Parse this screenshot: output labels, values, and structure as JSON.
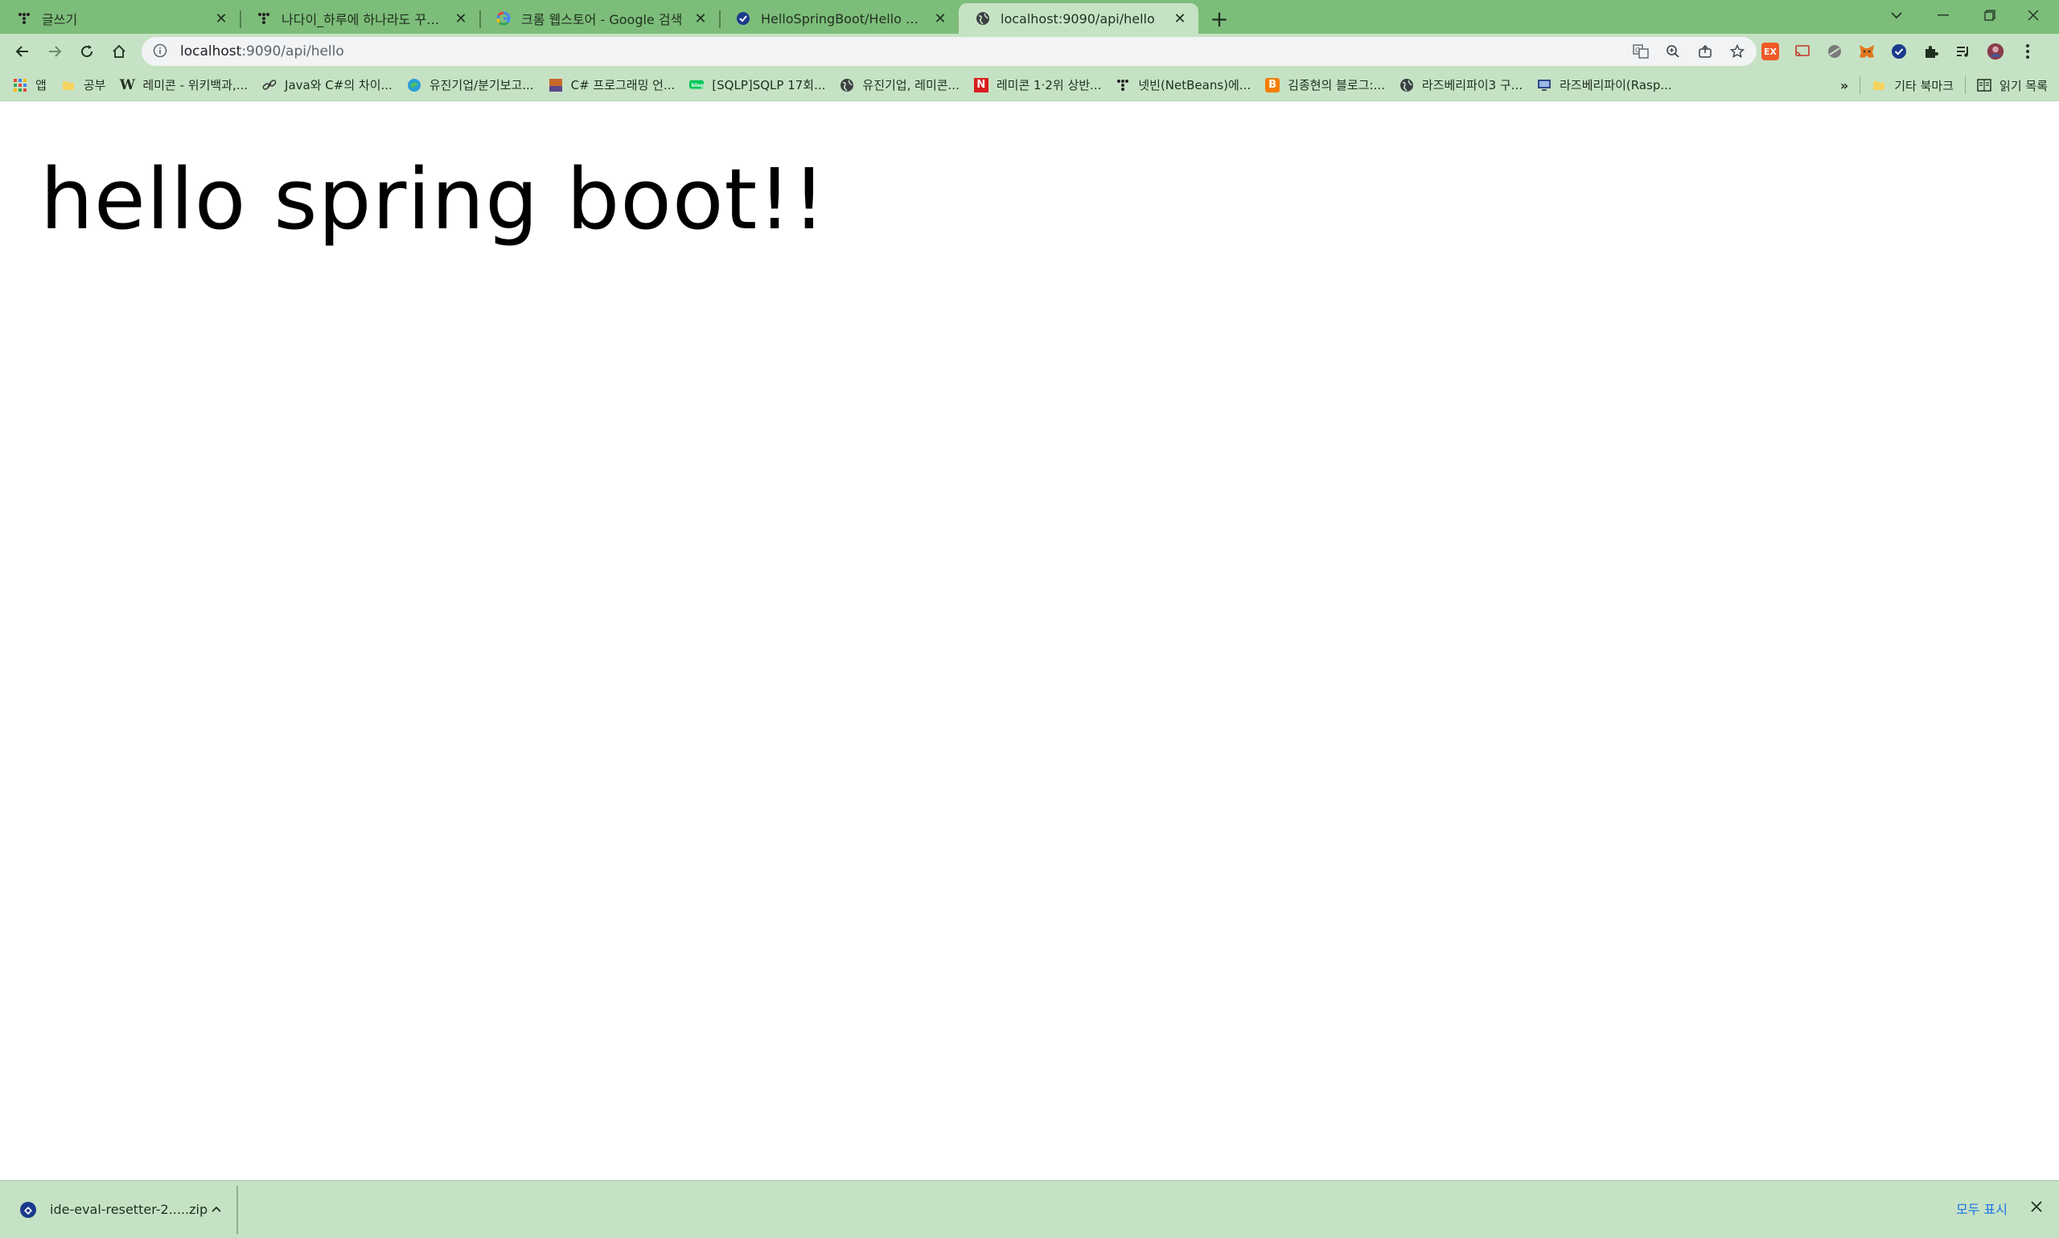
{
  "tabs": [
    {
      "title": "글쓰기",
      "icon": "tistory-icon",
      "active": false
    },
    {
      "title": "나다이_하루에 하나라도 꾸준히",
      "icon": "tistory-icon",
      "active": false
    },
    {
      "title": "크롬 웹스토어 - Google 검색",
      "icon": "google-icon",
      "active": false
    },
    {
      "title": "HelloSpringBoot/Hello Spring Boot",
      "icon": "check-circle-icon",
      "active": false
    },
    {
      "title": "localhost:9090/api/hello",
      "icon": "globe-icon",
      "active": true
    }
  ],
  "new_tab_label": "+",
  "address_bar": {
    "host": "localhost",
    "path": ":9090/api/hello"
  },
  "bookmarks": [
    {
      "label": "앱",
      "icon": "apps-grid-icon"
    },
    {
      "label": "공부",
      "icon": "folder-icon"
    },
    {
      "label": "레미콘 - 위키백과,...",
      "icon": "wikipedia-icon"
    },
    {
      "label": "Java와 C#의 차이...",
      "icon": "link-icon"
    },
    {
      "label": "유진기업/분기보고...",
      "icon": "edge-icon"
    },
    {
      "label": "C# 프로그래밍 언...",
      "icon": "image-icon"
    },
    {
      "label": "[SQLP]SQLP 17회...",
      "icon": "naver-blog-icon"
    },
    {
      "label": "유진기업, 레미콘...",
      "icon": "globe-icon"
    },
    {
      "label": "레미콘 1·2위 상반...",
      "icon": "news-n-icon"
    },
    {
      "label": "넷빈(NetBeans)에...",
      "icon": "tistory-icon"
    },
    {
      "label": "김종현의 블로그:...",
      "icon": "blogger-icon"
    },
    {
      "label": "라즈베리파이3 구...",
      "icon": "globe-icon"
    },
    {
      "label": "라즈베리파이(Rasp...",
      "icon": "monitor-icon"
    }
  ],
  "bookmarks_overflow": "»",
  "other_bookmarks": "기타 북마크",
  "reading_list": "읽기 목록",
  "page": {
    "heading": "hello spring boot!!"
  },
  "downloads": {
    "filename": "ide-eval-resetter-2.....zip",
    "show_all": "모두 표시"
  },
  "colors": {
    "tabstrip": "#7dbd7a",
    "toolbar": "#c6e2c4"
  }
}
